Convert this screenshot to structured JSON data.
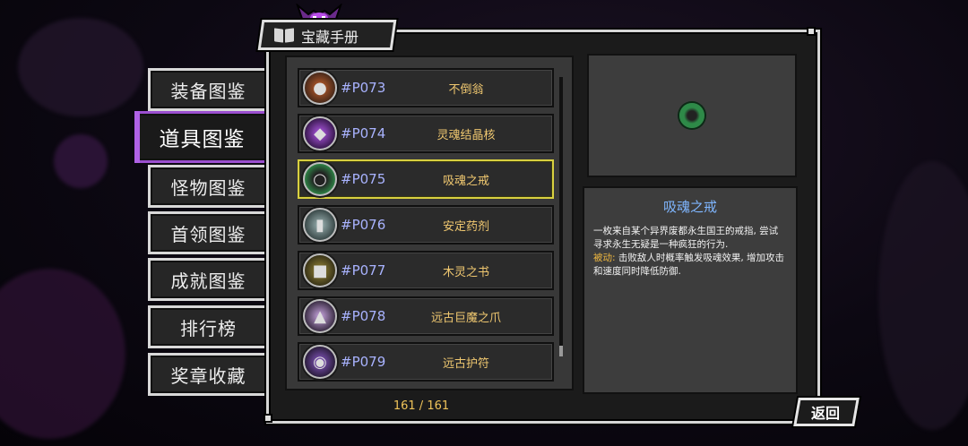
{
  "window": {
    "title": "宝藏手册",
    "back_label": "返回",
    "counter": "161 / 161"
  },
  "tabs": [
    {
      "label": "装备图鉴",
      "active": false
    },
    {
      "label": "道具图鉴",
      "active": true
    },
    {
      "label": "怪物图鉴",
      "active": false
    },
    {
      "label": "首领图鉴",
      "active": false
    },
    {
      "label": "成就图鉴",
      "active": false
    },
    {
      "label": "排行榜",
      "active": false
    },
    {
      "label": "奖章收藏",
      "active": false
    }
  ],
  "items": [
    {
      "code": "#P073",
      "name": "不倒翁",
      "icon": "tumbler-icon",
      "selected": false
    },
    {
      "code": "#P074",
      "name": "灵魂结晶核",
      "icon": "soul-crystal-icon",
      "selected": false
    },
    {
      "code": "#P075",
      "name": "吸魂之戒",
      "icon": "soul-ring-icon",
      "selected": true
    },
    {
      "code": "#P076",
      "name": "安定药剂",
      "icon": "potion-icon",
      "selected": false
    },
    {
      "code": "#P077",
      "name": "木灵之书",
      "icon": "wood-book-icon",
      "selected": false
    },
    {
      "code": "#P078",
      "name": "远古巨魔之爪",
      "icon": "claw-icon",
      "selected": false
    },
    {
      "code": "#P079",
      "name": "远古护符",
      "icon": "amulet-icon",
      "selected": false
    }
  ],
  "detail": {
    "title": "吸魂之戒",
    "description": "一枚来自某个异界废都永生国王的戒指, 尝试寻求永生无疑是一种疯狂的行为.",
    "passive_label": "被动:",
    "passive_text": " 击败敌人时概率触发吸魂效果, 增加攻击和速度同时降低防御.",
    "preview_icon": "soul-ring-icon"
  },
  "colors": {
    "accent_purple": "#9b4fcf",
    "selected_border": "#d8d040",
    "code_text": "#a9b3ff",
    "name_text": "#f0c870",
    "detail_title": "#7fb6ff",
    "passive_label": "#f0b840"
  }
}
